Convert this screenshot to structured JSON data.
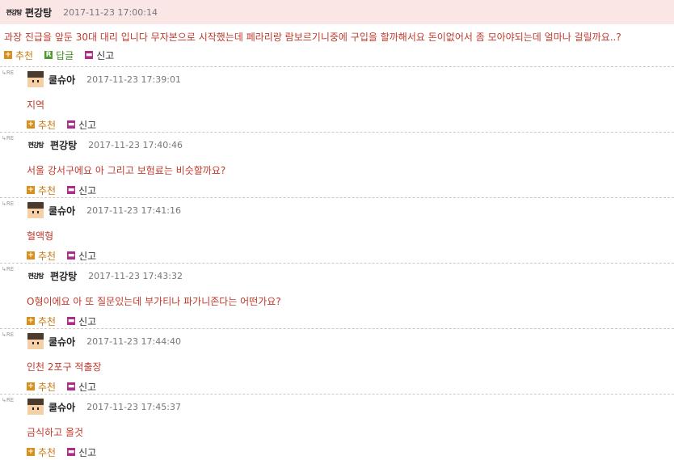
{
  "post": {
    "logo_text": "편강탕",
    "author": "편강탕",
    "time": "2017-11-23 17:00:14",
    "body": "과장 진급을 앞둔 30대 대리 입니다 무자본으로 시작했는데 페라리랑 람보르기니중에 구입을 할까해서요 돈이없어서 좀 모아야되는데 얼마나 걸릴까요..?",
    "actions": {
      "recommend": "추천",
      "reply": "답글",
      "report": "신고"
    }
  },
  "re_label": "RE",
  "comments": [
    {
      "author": "쿨슈아",
      "avatar": "pixel-avatar",
      "time": "2017-11-23 17:39:01",
      "body": "지역"
    },
    {
      "author": "편강탕",
      "avatar": "calligraphy-logo",
      "logo_text": "편강탕",
      "time": "2017-11-23 17:40:46",
      "body": "서울 강서구에요 아 그리고 보험료는 비슷할까요?"
    },
    {
      "author": "쿨슈아",
      "avatar": "pixel-avatar",
      "time": "2017-11-23 17:41:16",
      "body": "혈액형"
    },
    {
      "author": "편강탕",
      "avatar": "calligraphy-logo",
      "logo_text": "편강탕",
      "time": "2017-11-23 17:43:32",
      "body": "O형이에요 아 또 질문있는데 부가티나 파가니존다는 어떤가요?"
    },
    {
      "author": "쿨슈아",
      "avatar": "pixel-avatar",
      "time": "2017-11-23 17:44:40",
      "body": "인천 2포구 적출장"
    },
    {
      "author": "쿨슈아",
      "avatar": "pixel-avatar",
      "time": "2017-11-23 17:45:37",
      "body": "금식하고 올것"
    }
  ],
  "comment_actions": {
    "recommend": "추천",
    "report": "신고"
  },
  "colors": {
    "header_bg": "#fbe6e6",
    "body_text": "#c0392b",
    "recommend": "#d8901a",
    "reply": "#4c9b2f",
    "report": "#b02c8a"
  }
}
